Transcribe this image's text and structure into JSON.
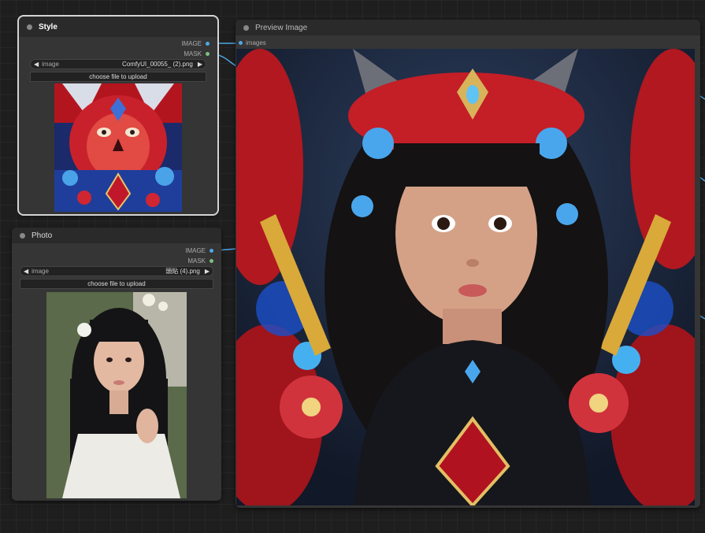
{
  "style_node": {
    "title": "Style",
    "outputs": [
      "IMAGE",
      "MASK"
    ],
    "widget": {
      "label": "image",
      "value": "ComfyUI_00055_ (2).png"
    },
    "upload_label": "choose file to upload"
  },
  "photo_node": {
    "title": "Photo",
    "outputs": [
      "IMAGE",
      "MASK"
    ],
    "widget": {
      "label": "image",
      "value": "頭貼 (4).png"
    },
    "upload_label": "choose file to upload"
  },
  "preview_node": {
    "title": "Preview Image",
    "inputs": [
      "images"
    ]
  },
  "icons": {
    "left": "◀",
    "right": "▶"
  },
  "colors": {
    "image_socket": "#4fa7e6",
    "mask_socket": "#7fbf7f",
    "link": "#4fa7e6"
  }
}
